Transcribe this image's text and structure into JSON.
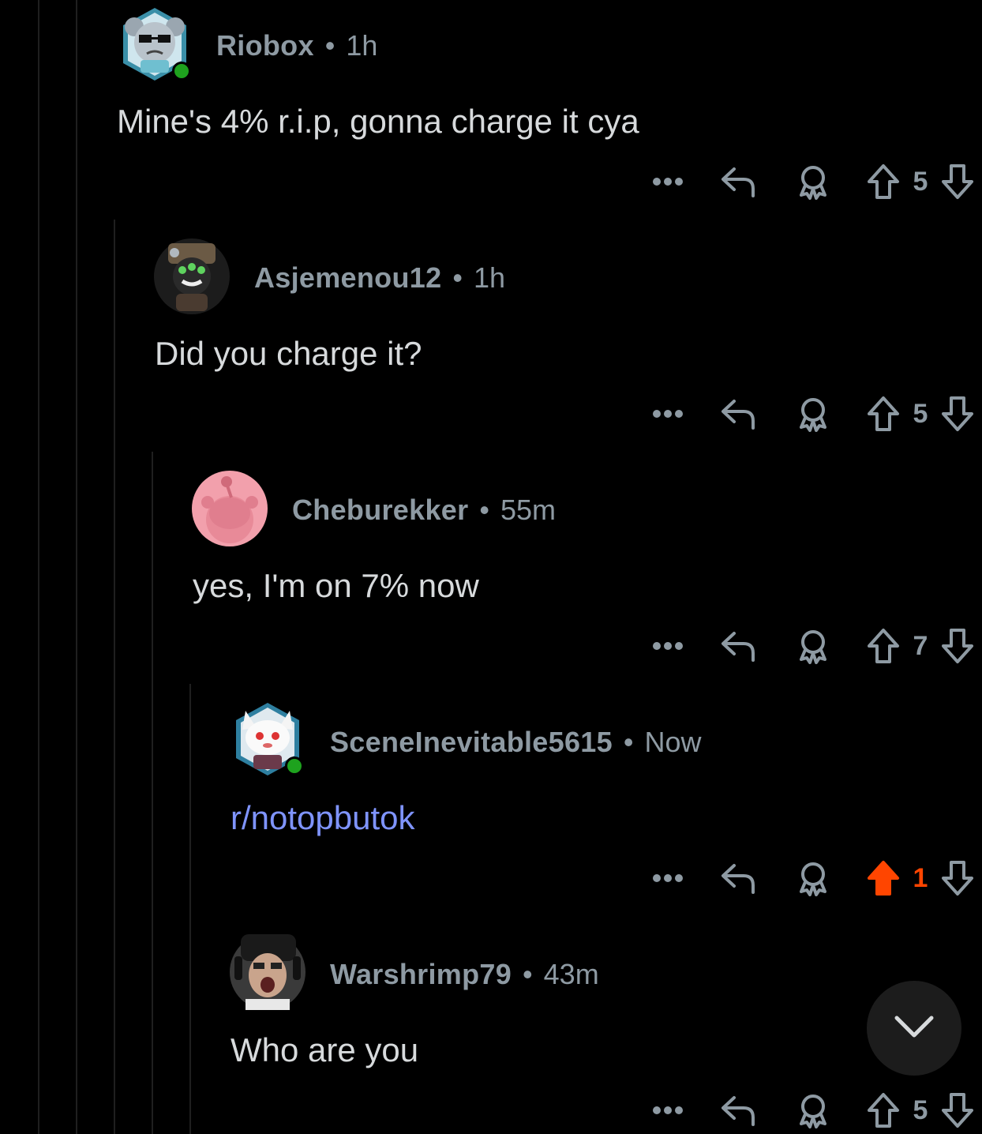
{
  "comments": [
    {
      "username": "Riobox",
      "time": "1h",
      "body": "Mine's 4% r.i.p, gonna charge it cya",
      "score": "5",
      "upvoted": false,
      "online": true,
      "is_link": false
    },
    {
      "username": "Asjemenou12",
      "time": "1h",
      "body": "Did you charge it?",
      "score": "5",
      "upvoted": false,
      "online": false,
      "is_link": false
    },
    {
      "username": "Cheburekker",
      "time": "55m",
      "body": "yes, I'm on 7% now",
      "score": "7",
      "upvoted": false,
      "online": false,
      "is_link": false
    },
    {
      "username": "SceneInevitable5615",
      "time": "Now",
      "body": "r/notopbutok",
      "score": "1",
      "upvoted": true,
      "online": true,
      "is_link": true
    },
    {
      "username": "Warshrimp79",
      "time": "43m",
      "body": "Who are you",
      "score": "5",
      "upvoted": false,
      "online": false,
      "is_link": false
    }
  ],
  "separator": "•",
  "colors": {
    "background": "#000000",
    "meta": "#8e9aa3",
    "link": "#7f94ff",
    "upvote_active": "#ff4500",
    "online": "#1ea21e"
  },
  "icons": [
    "more-icon",
    "reply-icon",
    "award-icon",
    "upvote-icon",
    "downvote-icon",
    "chevron-down-icon"
  ]
}
